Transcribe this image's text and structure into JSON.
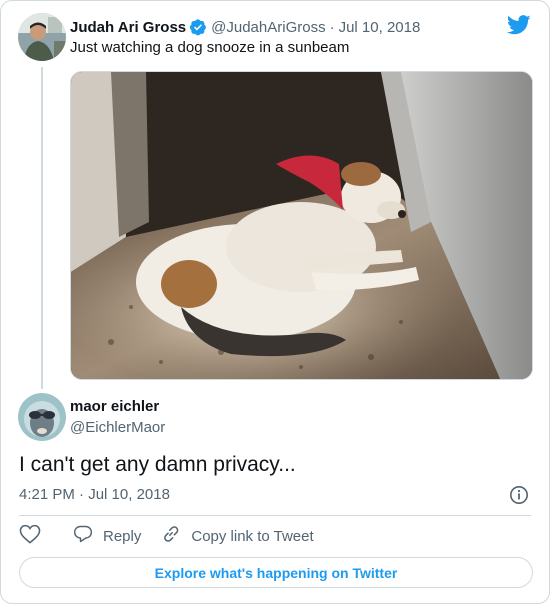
{
  "parent": {
    "name": "Judah Ari Gross",
    "handle": "@JudahAriGross",
    "separator": "·",
    "date": "Jul 10, 2018",
    "text": "Just watching a dog snooze in a sunbeam"
  },
  "tweet": {
    "name": "maor eichler",
    "handle": "@EichlerMaor",
    "text": "I can't get any damn privacy...",
    "time": "4:21 PM",
    "date": "Jul 10, 2018",
    "meta_separator": " · "
  },
  "actions": {
    "reply_label": "Reply",
    "copy_label": "Copy link to Tweet"
  },
  "footer": {
    "explore_label": "Explore what's happening on Twitter"
  },
  "colors": {
    "accent": "#1d9bf0",
    "verified": "#1d9bf0",
    "text": "#0f1419",
    "muted": "#536471",
    "border": "#cfd9de"
  },
  "icons": [
    "twitter-bird-icon",
    "verified-badge-icon",
    "heart-icon",
    "reply-icon",
    "link-icon",
    "info-icon"
  ]
}
